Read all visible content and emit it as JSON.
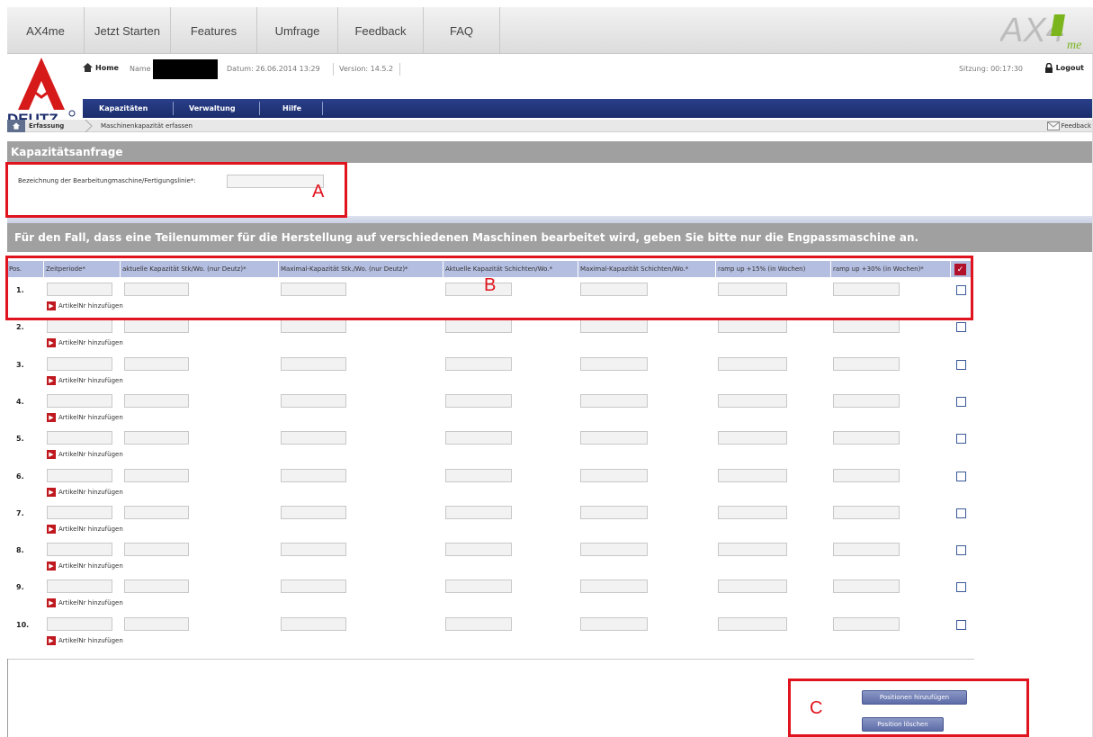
{
  "topnav": {
    "tabs": [
      "AX4me",
      "Jetzt Starten",
      "Features",
      "Umfrage",
      "Feedback",
      "FAQ"
    ],
    "logo_text": "AX4",
    "logo_sub": "me"
  },
  "header": {
    "home": "Home",
    "name_label": "Name",
    "date": "Datum: 26.06.2014 13:29",
    "version": "Version: 14.5.2",
    "session": "Sitzung: 00:17:30",
    "logout": "Logout",
    "brand": "DEUTZ"
  },
  "mainnav": [
    "Kapazitäten",
    "Verwaltung",
    "Hilfe"
  ],
  "breadcrumb": {
    "current": "Erfassung",
    "page": "Maschinenkapazität erfassen",
    "feedback": "Feedback"
  },
  "section": {
    "title": "Kapazitätsanfrage",
    "designation_label": "Bezeichnung der Bearbeitungmaschine/Fertigungslinie*:",
    "notice": "Für den Fall, dass eine Teilenummer für die Herstellung auf verschiedenen Maschinen bearbeitet wird, geben Sie bitte nur die Engpassmaschine an."
  },
  "table": {
    "headers": [
      "Pos.",
      "Zeitperiode*",
      "aktuelle Kapazität Stk/Wo. (nur Deutz)*",
      "Maximal-Kapazität Stk./Wo. (nur Deutz)*",
      "Aktuelle Kapazität Schichten/Wo.*",
      "Maximal-Kapazität Schichten/Wo.*",
      "ramp up +15% (in Wochen)",
      "ramp up +30% (in Wochen)*"
    ],
    "rows": [
      "1.",
      "2.",
      "3.",
      "4.",
      "5.",
      "6.",
      "7.",
      "8.",
      "9.",
      "10."
    ],
    "add_article": "ArtikelNr hinzufügen"
  },
  "buttons": {
    "add_positions": "Positionen hinzufügen",
    "delete_position": "Position löschen"
  },
  "annotations": [
    "A",
    "B",
    "C"
  ]
}
